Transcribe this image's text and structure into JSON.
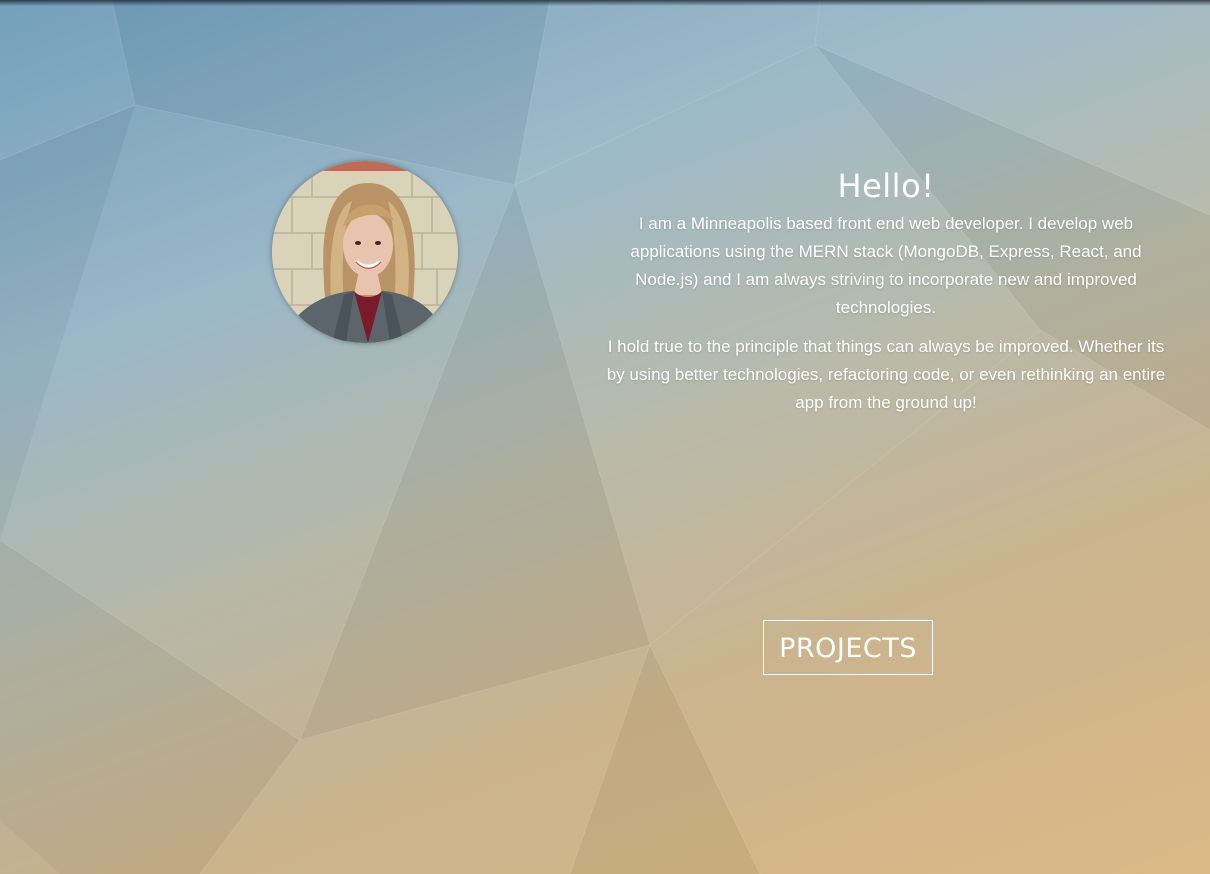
{
  "hero": {
    "heading": "Hello!",
    "paragraph_1": "I am a Minneapolis based front end web developer. I develop web applications using the MERN stack (MongoDB, Express, React, and Node.js) and I am always striving to incorporate new and improved technologies.",
    "paragraph_2": "I hold true to the principle that things can always be improved. Whether its by using better technologies, refactoring code, or even rethinking an entire app from the ground up!",
    "projects_button": "PROJECTS"
  },
  "colors": {
    "text": "#ffffff",
    "bg_top": "#6d9bb8",
    "bg_bottom": "#d9b680"
  }
}
